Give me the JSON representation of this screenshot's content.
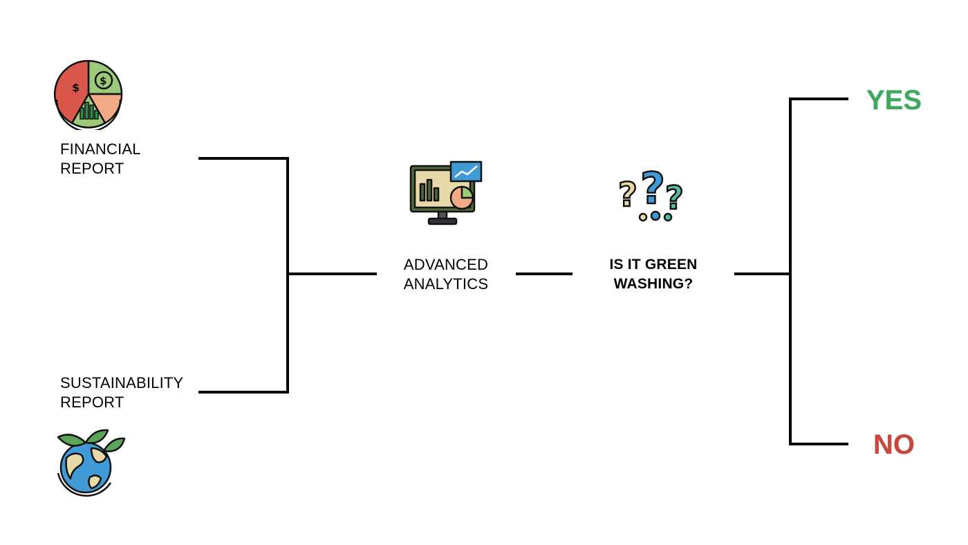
{
  "nodes": {
    "financial_report": "FINANCIAL\nREPORT",
    "sustainability_report": "SUSTAINABILITY\nREPORT",
    "advanced_analytics": "ADVANCED\nANALYTICS",
    "green_washing_question": "IS IT GREEN\nWASHING?"
  },
  "outcomes": {
    "yes": "YES",
    "no": "NO"
  },
  "colors": {
    "line": "#000000",
    "yes": "#3fa95f",
    "no": "#c8483d",
    "icon_red": "#d9584b",
    "icon_green": "#9cc97a",
    "icon_blue": "#3f9ad6",
    "icon_teal": "#5bb7a5",
    "icon_beige": "#e7d9a8",
    "icon_peach": "#f2a985"
  },
  "icons": {
    "financial": "pie-chart-money-icon",
    "analytics": "monitor-analytics-icon",
    "question": "question-marks-icon",
    "sustainability": "globe-leaves-icon"
  }
}
